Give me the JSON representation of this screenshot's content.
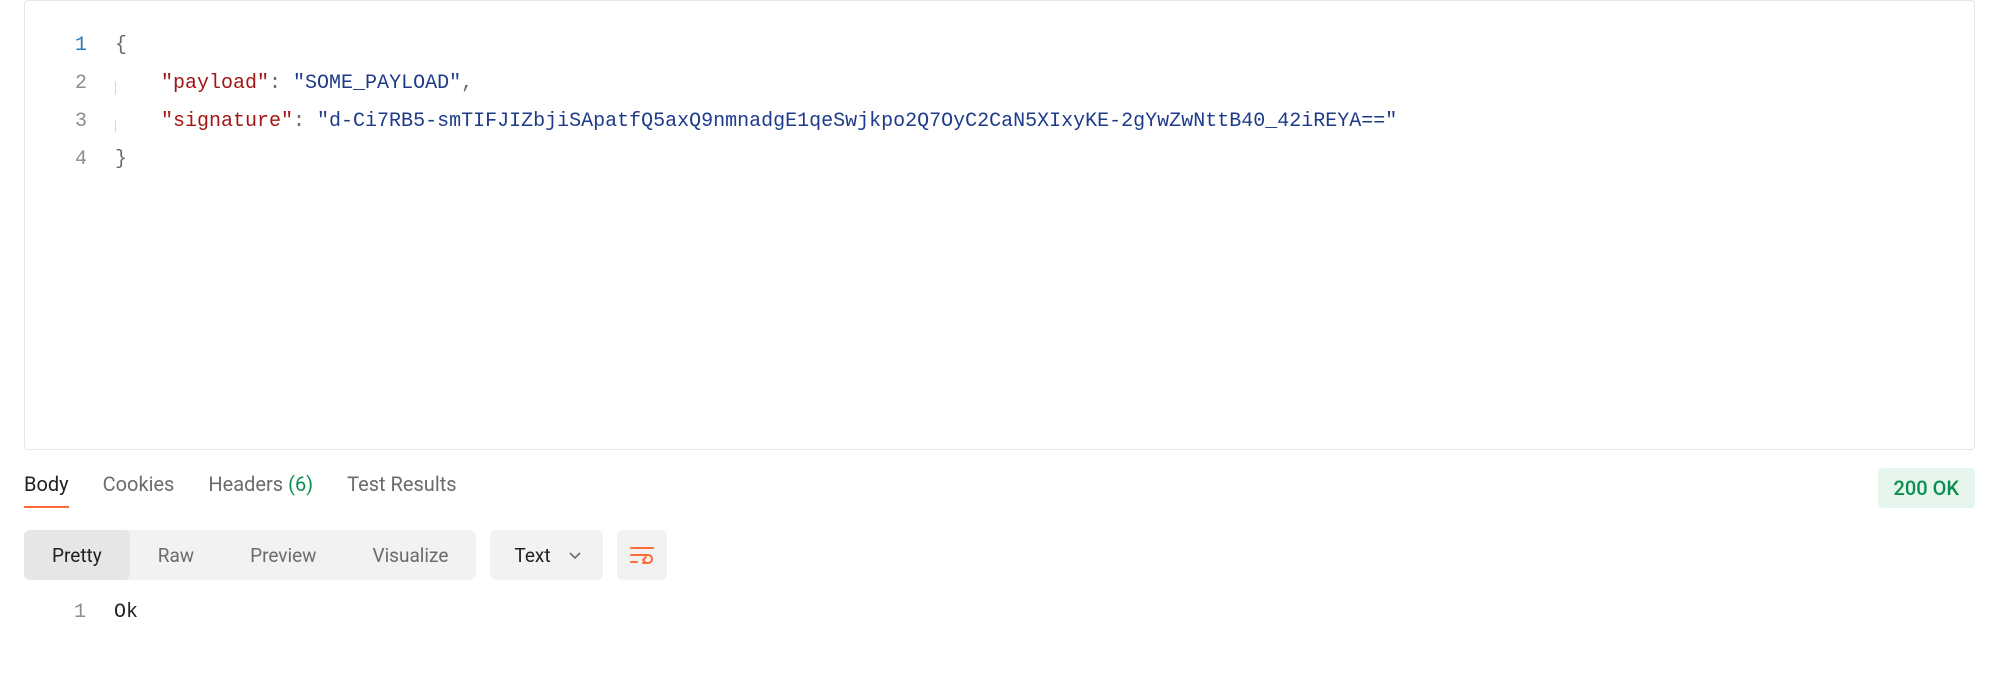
{
  "request_body": {
    "lines": [
      {
        "n": "1",
        "brace": "{"
      },
      {
        "n": "2",
        "key": "\"payload\"",
        "colon": ": ",
        "value": "\"SOME_PAYLOAD\"",
        "comma": ","
      },
      {
        "n": "3",
        "key": "\"signature\"",
        "colon": ": ",
        "value": "\"d-Ci7RB5-smTIFJIZbjiSApatfQ5axQ9nmnadgE1qeSwjkpo2Q7OyC2CaN5XIxyKE-2gYwZwNttB40_42iREYA==\""
      },
      {
        "n": "4",
        "brace": "}"
      }
    ]
  },
  "response_tabs": {
    "body": "Body",
    "cookies": "Cookies",
    "headers_label": "Headers",
    "headers_count": "(6)",
    "test_results": "Test Results"
  },
  "status": {
    "text": "200 OK"
  },
  "view_modes": {
    "pretty": "Pretty",
    "raw": "Raw",
    "preview": "Preview",
    "visualize": "Visualize"
  },
  "format_dropdown": {
    "selected": "Text"
  },
  "icons": {
    "wrap": "wrap-lines-icon",
    "chevron": "chevron-down-icon"
  },
  "response_body": {
    "lines": [
      {
        "n": "1",
        "text": "Ok"
      }
    ]
  }
}
